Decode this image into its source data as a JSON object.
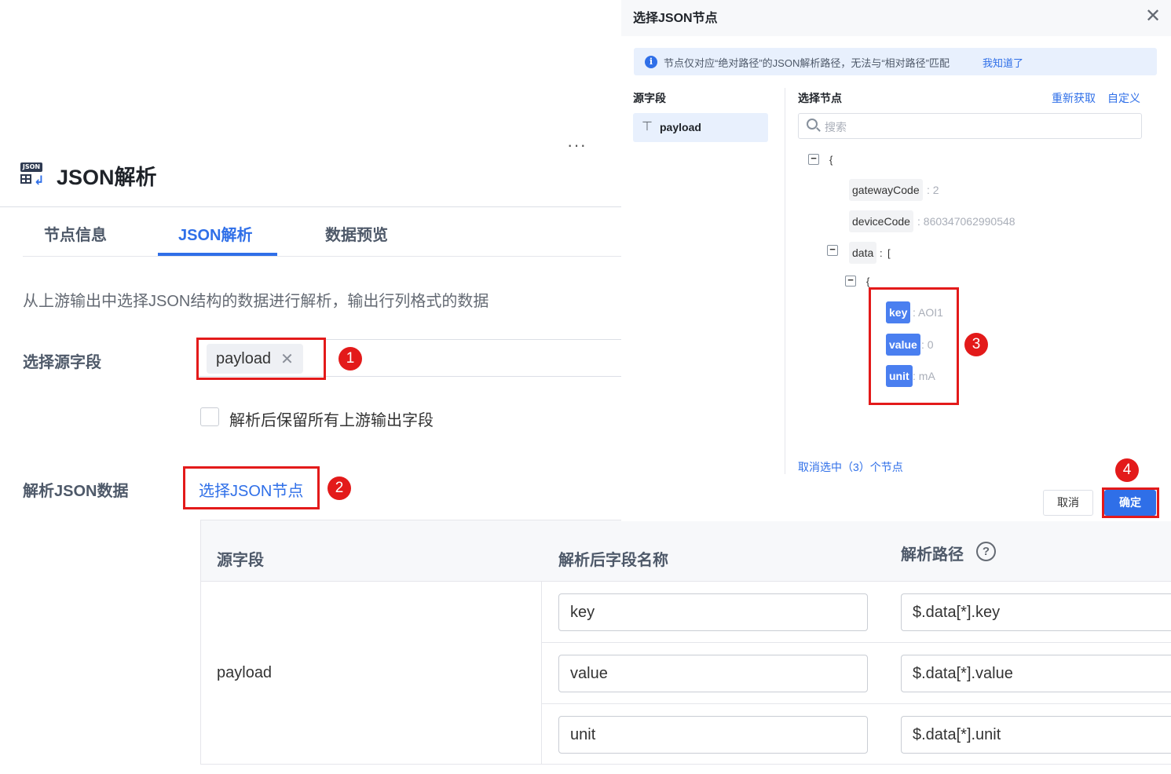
{
  "header": {
    "title": "JSON解析",
    "logo_text": "JSON",
    "more_label": "···"
  },
  "tabs": [
    {
      "label": "节点信息",
      "active": false
    },
    {
      "label": "JSON解析",
      "active": true
    },
    {
      "label": "数据预览",
      "active": false
    }
  ],
  "description": "从上游输出中选择JSON结构的数据进行解析，输出行列格式的数据",
  "source_field": {
    "label": "选择源字段",
    "selected": "payload",
    "remove_glyph": "✕"
  },
  "keep_fields": {
    "label": "解析后保留所有上游输出字段",
    "checked": false
  },
  "parse_json": {
    "label": "解析JSON数据",
    "link": "选择JSON节点"
  },
  "badges": [
    "1",
    "2",
    "3",
    "4"
  ],
  "table": {
    "headers": [
      "源字段",
      "解析后字段名称",
      "解析路径"
    ],
    "help_glyph": "?",
    "source": "payload",
    "rows": [
      {
        "name": "key",
        "path": "$.data[*].key"
      },
      {
        "name": "value",
        "path": "$.data[*].value"
      },
      {
        "name": "unit",
        "path": "$.data[*].unit"
      }
    ]
  },
  "dialog": {
    "title": "选择JSON节点",
    "close_glyph": "✕",
    "info_text": "节点仅对应“绝对路径”的JSON解析路径，无法与“相对路径”匹配",
    "info_link": "我知道了",
    "source_title": "源字段",
    "source_item": "payload",
    "node_title": "选择节点",
    "refresh_link": "重新获取",
    "custom_link": "自定义",
    "search_placeholder": "搜索",
    "tree": {
      "open_brace": "{",
      "open_bracket": "[",
      "collapse_glyph": "−",
      "gatewayCode": {
        "key": "gatewayCode",
        "value": ": 2"
      },
      "deviceCode": {
        "key": "deviceCode",
        "value": ": 860347062990548"
      },
      "data": {
        "key": "data",
        "value": ":"
      },
      "item_key": {
        "key": "key",
        "value": ": AOI1"
      },
      "item_value": {
        "key": "value",
        "value": ": 0"
      },
      "item_unit": {
        "key": "unit",
        "value": ": mA"
      }
    },
    "unselect_link": "取消选中（3）个节点",
    "cancel": "取消",
    "confirm": "确定"
  },
  "colors": {
    "accent": "#2f6fe8",
    "annotation_red": "#e31a1a",
    "selected_node": "#4a7ff0"
  }
}
